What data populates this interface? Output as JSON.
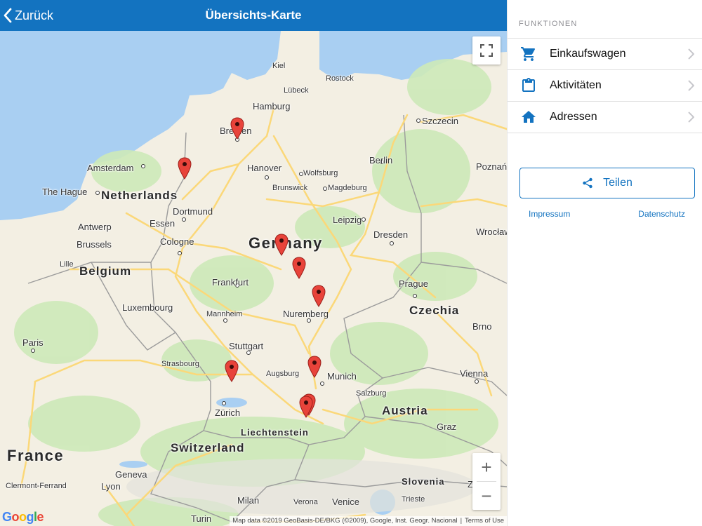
{
  "topbar": {
    "back_label": "Zurück",
    "title": "Übersichts-Karte"
  },
  "map": {
    "labels": {
      "kiel": "Kiel",
      "rostock": "Rostock",
      "luebeck": "Lübeck",
      "hamburg": "Hamburg",
      "bremen": "Bremen",
      "szczecin": "Szczecin",
      "amsterdam": "Amsterdam",
      "berlin": "Berlin",
      "poznan": "Poznań",
      "hanover": "Hanover",
      "wolfsburg": "Wolfsburg",
      "brunswick": "Brunswick",
      "magdeburg": "Magdeburg",
      "the_hague": "The Hague",
      "netherlands": "Netherlands",
      "dortmund": "Dortmund",
      "essen": "Essen",
      "antwerp": "Antwerp",
      "leipzig": "Leipzig",
      "brussels": "Brussels",
      "cologne": "Cologne",
      "germany": "Germany",
      "dresden": "Dresden",
      "wroclaw": "Wrocław",
      "lille": "Lille",
      "belgium": "Belgium",
      "frankfurt": "Frankfurt",
      "prague": "Prague",
      "luxembourg": "Luxembourg",
      "mannheim": "Mannheim",
      "nuremberg": "Nuremberg",
      "czechia": "Czechia",
      "brno": "Brno",
      "paris": "Paris",
      "stuttgart": "Stuttgart",
      "strasbourg": "Strasbourg",
      "augsburg": "Augsburg",
      "munich": "Munich",
      "vienna": "Vienna",
      "salzburg": "Salzburg",
      "austria": "Austria",
      "zurich": "Zürich",
      "liechtenstein": "Liechtenstein",
      "graz": "Graz",
      "switzerland": "Switzerland",
      "france": "France",
      "geneva": "Geneva",
      "slovenia": "Slovenia",
      "zagreb": "Zagre",
      "clermont": "Clermont-Ferrand",
      "lyon": "Lyon",
      "trieste": "Trieste",
      "milan": "Milan",
      "verona": "Verona",
      "venice": "Venice",
      "turin": "Turin"
    },
    "marker_count": 9,
    "google_logo": "Google",
    "attribution": {
      "map_data": "Map data ©2019 GeoBasis-DE/BKG (©2009), Google, Inst. Geogr. Nacional",
      "terms": "Terms of Use"
    },
    "colors": {
      "marker": "#e8433a",
      "water": "#a9cff2",
      "land": "#f3efe3",
      "park": "#cde9b8",
      "road": "#fbd879"
    }
  },
  "panel": {
    "heading": "FUNKTIONEN",
    "menu": [
      {
        "label": "Einkaufswagen",
        "icon": "cart-icon"
      },
      {
        "label": "Aktivitäten",
        "icon": "clipboard-icon"
      },
      {
        "label": "Adressen",
        "icon": "home-icon"
      }
    ],
    "share_label": "Teilen",
    "impressum": "Impressum",
    "datenschutz": "Datenschutz",
    "accent": "#1373c0"
  }
}
